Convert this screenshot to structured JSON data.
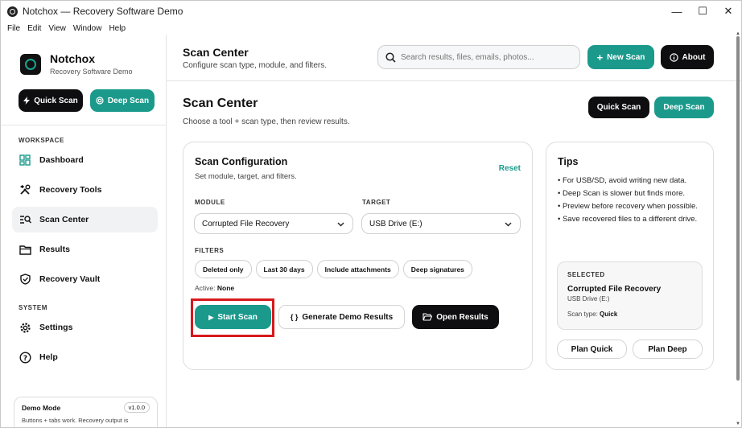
{
  "window": {
    "title": "Notchox — Recovery Software Demo",
    "min": "—",
    "max": "☐",
    "close": "✕"
  },
  "menu": [
    "File",
    "Edit",
    "View",
    "Window",
    "Help"
  ],
  "brand": {
    "name": "Notchox",
    "subtitle": "Recovery Software Demo"
  },
  "sidebar": {
    "quick_scan": "Quick Scan",
    "deep_scan": "Deep Scan",
    "workspace_label": "WORKSPACE",
    "workspace_items": [
      {
        "label": "Dashboard",
        "icon": "dashboard-icon"
      },
      {
        "label": "Recovery Tools",
        "icon": "tools-icon"
      },
      {
        "label": "Scan Center",
        "icon": "scan-search-icon",
        "active": true
      },
      {
        "label": "Results",
        "icon": "folder-icon"
      },
      {
        "label": "Recovery Vault",
        "icon": "shield-icon"
      }
    ],
    "system_label": "SYSTEM",
    "system_items": [
      {
        "label": "Settings",
        "icon": "gear-icon"
      },
      {
        "label": "Help",
        "icon": "help-icon"
      }
    ],
    "demo": {
      "title": "Demo Mode",
      "version": "v1.0.0",
      "text": "Buttons + tabs work. Recovery output is"
    }
  },
  "topbar": {
    "title": "Scan Center",
    "subtitle": "Configure scan type, module, and filters.",
    "search_placeholder": "Search results, files, emails, photos...",
    "new_scan": "New Scan",
    "about": "About"
  },
  "content": {
    "title": "Scan Center",
    "subtitle": "Choose a tool + scan type, then review results.",
    "quick_scan": "Quick Scan",
    "deep_scan": "Deep Scan"
  },
  "config": {
    "title": "Scan Configuration",
    "subtitle": "Set module, target, and filters.",
    "reset": "Reset",
    "module_label": "MODULE",
    "module_value": "Corrupted File Recovery",
    "target_label": "TARGET",
    "target_value": "USB Drive (E:)",
    "filters_label": "FILTERS",
    "filters": [
      "Deleted only",
      "Last 30 days",
      "Include attachments",
      "Deep signatures"
    ],
    "active_prefix": "Active:",
    "active_value": "None",
    "start_scan": "Start Scan",
    "generate": "Generate Demo Results",
    "open_results": "Open Results"
  },
  "tips": {
    "title": "Tips",
    "items": [
      "• For USB/SD, avoid writing new data.",
      "• Deep Scan is slower but finds more.",
      "• Preview before recovery when possible.",
      "• Save recovered files to a different drive."
    ],
    "selected_label": "SELECTED",
    "selected_name": "Corrupted File Recovery",
    "selected_target": "USB Drive (E:)",
    "scan_type_prefix": "Scan type:",
    "scan_type_value": "Quick",
    "plan_quick": "Plan Quick",
    "plan_deep": "Plan Deep"
  },
  "colors": {
    "accent": "#1b9a8c",
    "dark": "#0e0e10",
    "highlight": "#d7191c"
  }
}
